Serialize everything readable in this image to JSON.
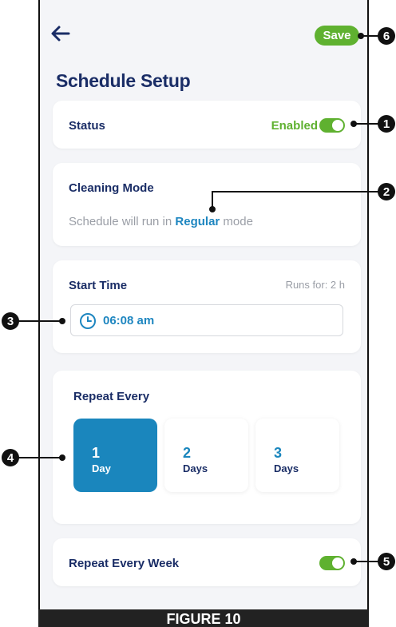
{
  "header": {
    "save_label": "Save",
    "title": "Schedule Setup"
  },
  "status": {
    "label": "Status",
    "value": "Enabled",
    "enabled": true
  },
  "cleaning_mode": {
    "label": "Cleaning Mode",
    "text_before": "Schedule will run in ",
    "mode": "Regular",
    "text_after": " mode"
  },
  "start_time": {
    "label": "Start Time",
    "runs_for": "Runs for: 2 h",
    "value": "06:08 am"
  },
  "repeat_every": {
    "label": "Repeat Every",
    "options": [
      {
        "number": "1",
        "unit": "Day",
        "selected": true
      },
      {
        "number": "2",
        "unit": "Days",
        "selected": false
      },
      {
        "number": "3",
        "unit": "Days",
        "selected": false
      }
    ]
  },
  "repeat_week": {
    "label": "Repeat Every Week",
    "enabled": true
  },
  "figure_caption": "FIGURE 10",
  "callouts": [
    "1",
    "2",
    "3",
    "4",
    "5",
    "6"
  ],
  "colors": {
    "accent_green": "#5fb130",
    "accent_blue": "#1a86bd",
    "title_navy": "#1a2d66"
  }
}
